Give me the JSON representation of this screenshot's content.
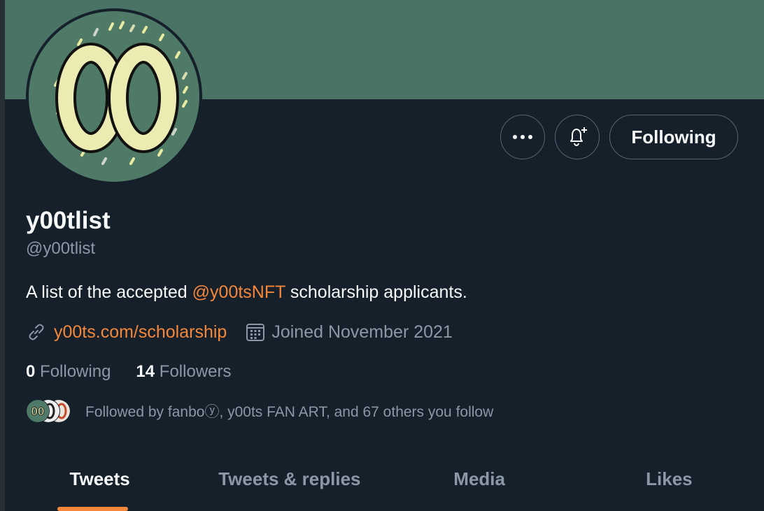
{
  "profile": {
    "name": "y00tlist",
    "handle": "@y00tlist",
    "bio_prefix": "A list of the accepted ",
    "bio_mention": "@y00tsNFT",
    "bio_suffix": " scholarship applicants.",
    "website": "y00ts.com/scholarship",
    "joined": "Joined November 2021",
    "avatar_text": "00"
  },
  "actions": {
    "following_label": "Following"
  },
  "counts": {
    "following_value": "0",
    "following_label": "Following",
    "followers_value": "14",
    "followers_label": "Followers"
  },
  "followed_by": {
    "text": "Followed by fanboⓨ, y00ts FAN ART, and 67 others you follow",
    "mini_avatar_text": "00"
  },
  "tabs": [
    {
      "label": "Tweets",
      "active": true
    },
    {
      "label": "Tweets & replies",
      "active": false
    },
    {
      "label": "Media",
      "active": false
    },
    {
      "label": "Likes",
      "active": false
    }
  ],
  "colors": {
    "background": "#15202b",
    "banner": "#4a7265",
    "accent": "#f5873a",
    "secondary_text": "#8b98a5"
  },
  "icons": {
    "more": "more-horizontal-icon",
    "notify": "bell-plus-icon",
    "link": "link-icon",
    "calendar": "calendar-icon"
  }
}
